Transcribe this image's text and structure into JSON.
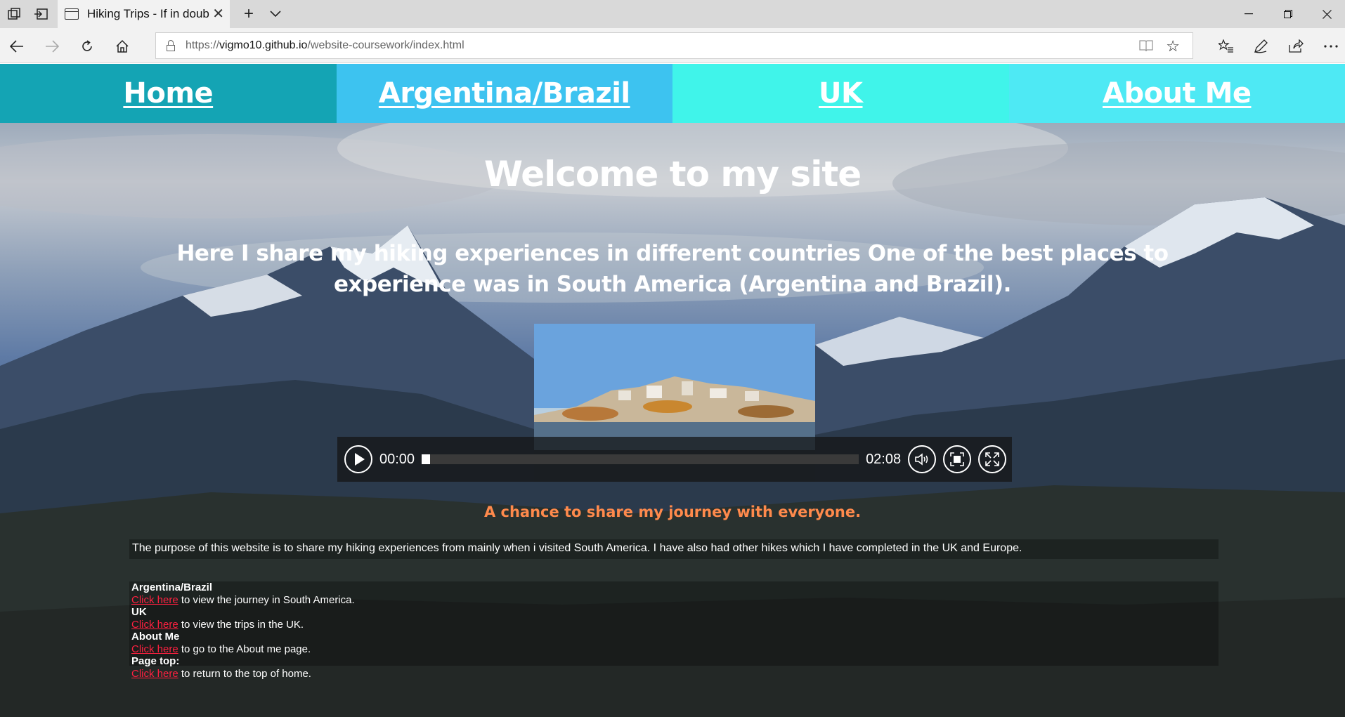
{
  "browser": {
    "tab_title": "Hiking Trips - If in doub",
    "url_prefix": "https://",
    "url_host": "vigmo10.github.io",
    "url_path": "/website-coursework/index.html"
  },
  "nav": {
    "items": [
      {
        "label": "Home",
        "color": "#14a4b4"
      },
      {
        "label": "Argentina/Brazil",
        "color": "#3dc3f0"
      },
      {
        "label": "UK",
        "color": "#40f4ea"
      },
      {
        "label": "About Me",
        "color": "#4ee9f4"
      }
    ]
  },
  "main": {
    "heading": "Welcome to my site",
    "intro": "Here I share my hiking experiences in different countries One of the best places to experience was in South America (Argentina and Brazil).",
    "video": {
      "current_time": "00:00",
      "duration": "02:08",
      "progress": 0
    },
    "subheading": "A chance to share my journey with everyone.",
    "purpose": "The purpose of this website is to share my hiking experiences from mainly when i visited South America. I have also had other hikes which I have completed in the UK and Europe.",
    "links": [
      {
        "label": "Argentina/Brazil",
        "link_text": "Click here",
        "rest": " to view the journey in South America."
      },
      {
        "label": "UK",
        "link_text": "Click here",
        "rest": " to view the trips in the UK."
      },
      {
        "label": "About Me",
        "link_text": "Click here",
        "rest": " to go to the About me page."
      },
      {
        "label": "Page top:",
        "link_text": "Click here",
        "rest": " to return to the top of home."
      }
    ]
  },
  "icons": {
    "tab_actions": "tab-set-aside-icon",
    "tab_preview": "tab-preview-icon",
    "new_tab": "plus-icon",
    "tab_list": "chevron-down-icon",
    "minimize": "minimize-icon",
    "restore": "restore-icon",
    "close": "close-icon",
    "back": "back-arrow-icon",
    "forward": "forward-arrow-icon",
    "refresh": "refresh-icon",
    "home": "home-icon",
    "reading_view": "reading-view-icon",
    "favorite": "star-icon",
    "favorites_hub": "favorites-list-icon",
    "notes": "pen-icon",
    "share": "share-icon",
    "more": "more-icon"
  },
  "colors": {
    "accent_orange": "#ff8a4c",
    "link_red": "#ff2040"
  }
}
